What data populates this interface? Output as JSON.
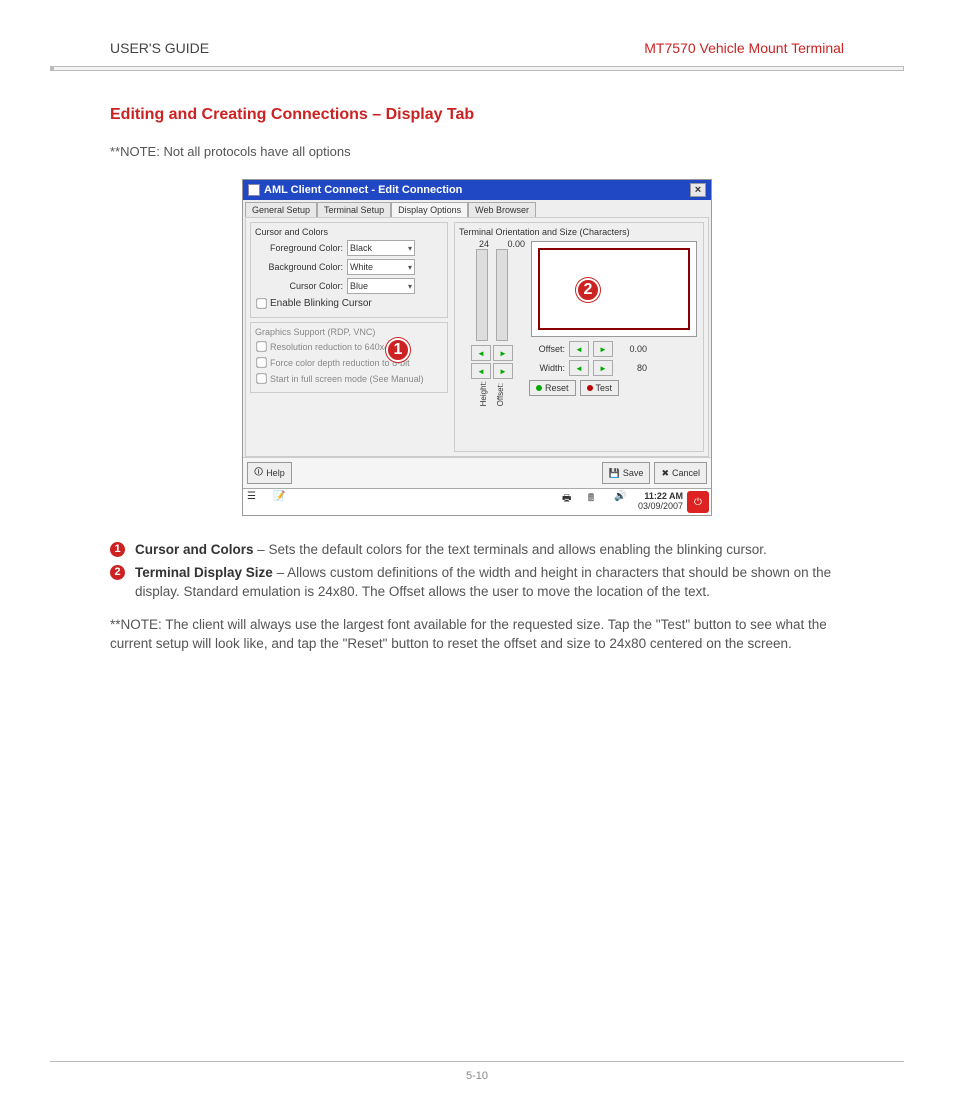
{
  "header": {
    "left": "USER'S GUIDE",
    "right": "MT7570 Vehicle Mount Terminal"
  },
  "section_title": "Editing and Creating Connections – Display Tab",
  "note_top": "**NOTE: Not all protocols have all options",
  "screenshot": {
    "title": "AML Client Connect - Edit Connection",
    "tabs": [
      "General Setup",
      "Terminal Setup",
      "Display Options",
      "Web Browser"
    ],
    "active_tab_index": 2,
    "cursor_colors": {
      "group_title": "Cursor and Colors",
      "foreground_label": "Foreground Color:",
      "foreground_value": "Black",
      "background_label": "Background Color:",
      "background_value": "White",
      "cursor_label": "Cursor Color:",
      "cursor_value": "Blue",
      "blink_label": "Enable Blinking Cursor"
    },
    "graphics": {
      "group_title": "Graphics Support (RDP, VNC)",
      "opt1": "Resolution reduction to 640x480",
      "opt2": "Force color depth reduction to 8-bit",
      "opt3": "Start in full screen mode (See Manual)"
    },
    "orientation": {
      "group_title": "Terminal Orientation and Size (Characters)",
      "height_label": "Height:",
      "offset_label": "Offset:",
      "width_label": "Width:",
      "height_value": "24",
      "offset_value_top": "0.00",
      "offset_value": "0.00",
      "width_value": "80",
      "reset_label": "Reset",
      "test_label": "Test"
    },
    "footer": {
      "help": "Help",
      "save": "Save",
      "cancel": "Cancel"
    },
    "taskbar": {
      "time": "11:22 AM",
      "date": "03/09/2007"
    }
  },
  "callouts": {
    "one": "1",
    "two": "2"
  },
  "legend": {
    "item1_title": "Cursor and Colors",
    "item1_body": " – Sets the default colors for the text terminals and allows enabling the blinking cursor.",
    "item2_title": "Terminal Display Size",
    "item2_body": " – Allows custom definitions of the width and height in characters that should be shown on the display.  Standard emulation is 24x80.  The Offset allows the user to move the location of the text."
  },
  "note_bottom": "**NOTE: The client will always use the largest font available for the requested size.  Tap the \"Test\" button to see what the current setup will look like, and tap the \"Reset\" button to reset the offset and size to 24x80 centered on the screen.",
  "page_number": "5-10"
}
